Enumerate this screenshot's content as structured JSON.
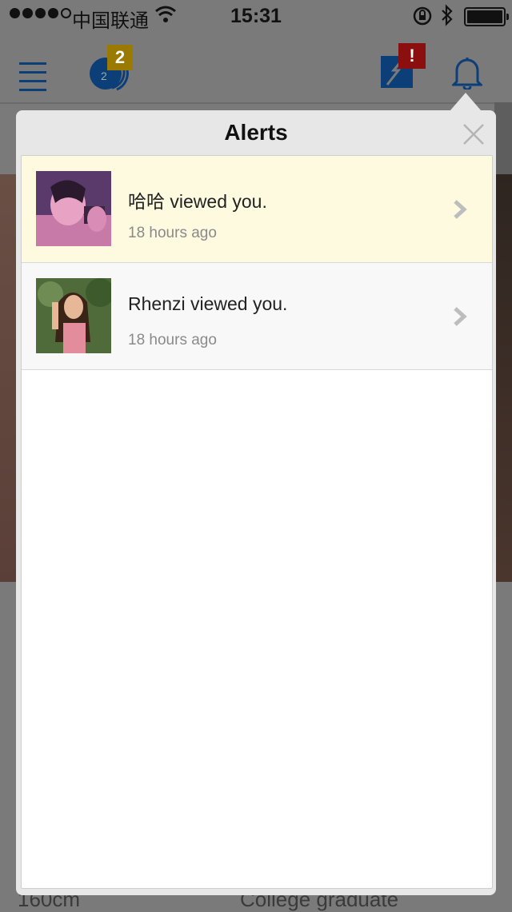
{
  "status_bar": {
    "carrier": "中国联通",
    "time": "15:31"
  },
  "navbar": {
    "logo_badge": "2",
    "messages_badge": "!"
  },
  "alerts_panel": {
    "title": "Alerts",
    "items": [
      {
        "name": "哈哈",
        "text": "哈哈 viewed you.",
        "time": "18 hours ago",
        "state": "unread"
      },
      {
        "name": "Rhenzi",
        "text": "Rhenzi viewed you.",
        "time": "18 hours ago",
        "state": "read"
      }
    ]
  },
  "background": {
    "height": "160cm",
    "education": "College graduate"
  },
  "colors": {
    "brand_blue": "#0c3f78",
    "unread_bg": "#fefae0",
    "logo_badge": "#9a7a00",
    "alert_badge": "#8c0f0f"
  }
}
